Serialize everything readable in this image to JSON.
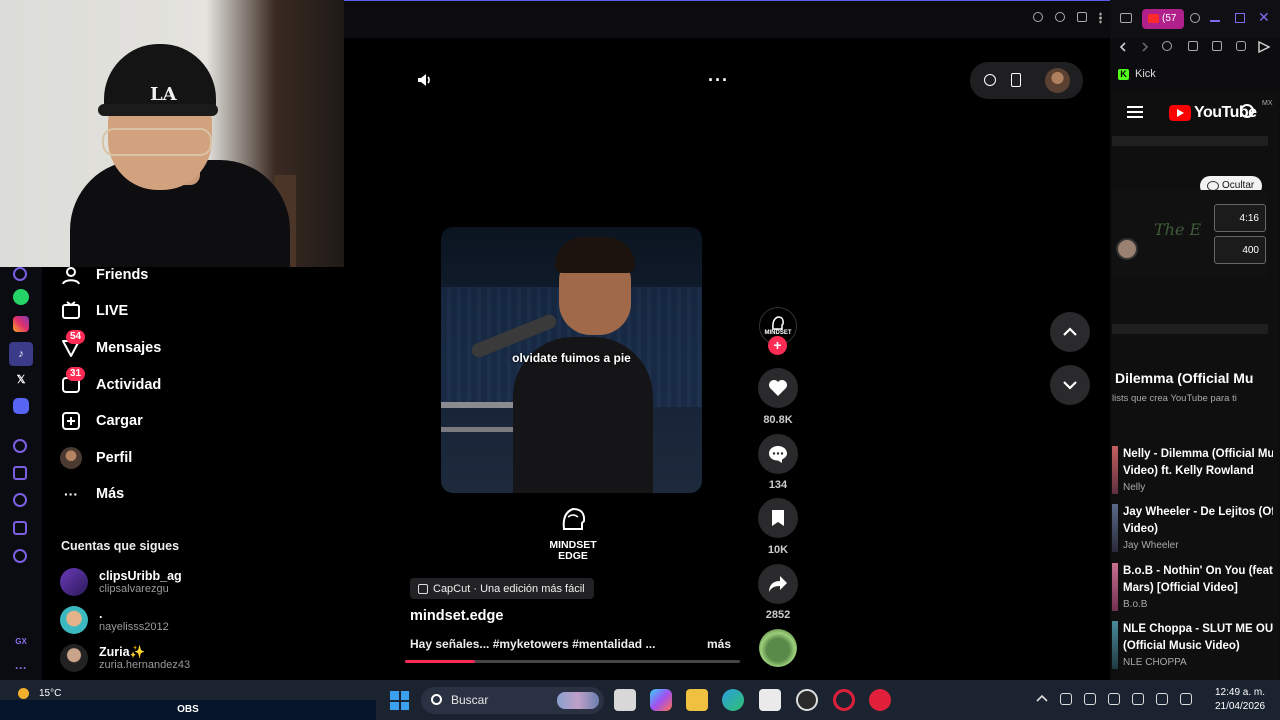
{
  "webcam": {
    "cap_logo": "LA"
  },
  "nav": {
    "items": [
      {
        "label": "Friends"
      },
      {
        "label": "LIVE"
      },
      {
        "label": "Mensajes",
        "badge": "54"
      },
      {
        "label": "Actividad",
        "badge": "31"
      },
      {
        "label": "Cargar"
      },
      {
        "label": "Perfil"
      },
      {
        "label": "Más"
      }
    ],
    "following_title": "Cuentas que sigues",
    "following": [
      {
        "name": "clipsUribb_ag",
        "handle": "clipsalvarezgu"
      },
      {
        "name": ".",
        "handle": "nayelisss2012"
      },
      {
        "name": "Zuria✨",
        "handle": "zuria.hernandez43"
      }
    ]
  },
  "video": {
    "caption": "olvidate fuimos a pie",
    "brand": [
      "MINDSET",
      "EDGE"
    ],
    "capcut_label": "CapCut · Una edición más fácil",
    "author": "mindset.edge",
    "description": "Hay señales... #myketowers #mentalidad ...",
    "more_label": "más",
    "progress": 0.21
  },
  "actions": {
    "avatar_text": "MINDSET",
    "likes": "80.8K",
    "comments": "134",
    "saves": "10K",
    "shares": "2852"
  },
  "sidebar": {
    "yt_badge": "(57",
    "kick_label": "Kick",
    "youtube": {
      "logo": "YouTube",
      "region": "MX",
      "hide_button": "Ocultar",
      "ad_title": "The E",
      "chip_duration": "4:16",
      "chip_count": "400",
      "playlist_title": "Dilemma (Official Mu",
      "playlist_sub": "lists que crea YouTube para ti",
      "items": [
        {
          "title_1": "Nelly - Dilemma (Official Mu",
          "title_2": "Video) ft. Kelly Rowland",
          "artist": "Nelly"
        },
        {
          "title_1": "Jay Wheeler - De Lejitos (Of",
          "title_2": "Video)",
          "artist": "Jay Wheeler"
        },
        {
          "title_1": "B.o.B - Nothin' On You (feat.",
          "title_2": "Mars) [Official Video]",
          "artist": "B.o.B"
        },
        {
          "title_1": "NLE Choppa - SLUT ME OUT",
          "title_2": "(Official Music Video)",
          "artist": "NLE CHOPPA"
        }
      ]
    }
  },
  "taskbar": {
    "temperature": "15°C",
    "obs_label": "OBS",
    "search_placeholder": "Buscar",
    "time": "12:49 a. m.",
    "date": "21/04/2026"
  },
  "colors": {
    "accent": "#fe2c55",
    "background": "#000000",
    "taskbar": "#1b2230"
  }
}
